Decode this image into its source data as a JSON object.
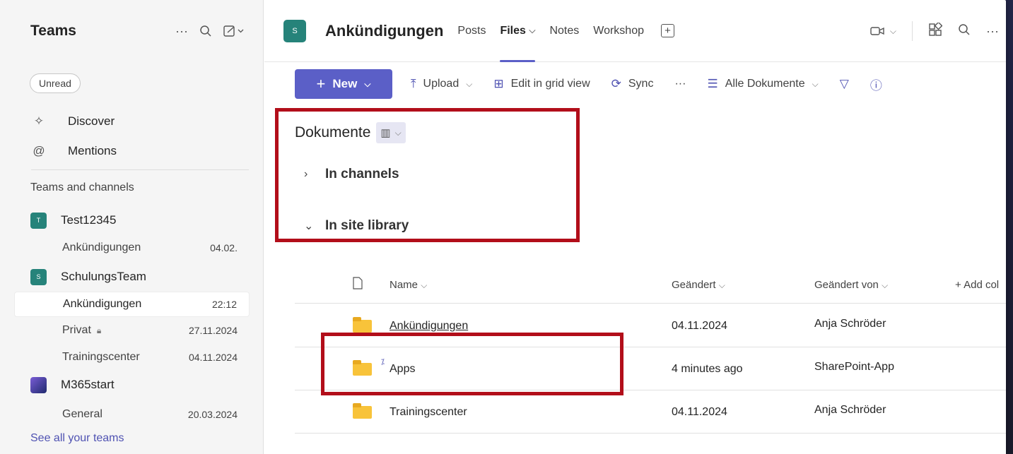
{
  "sidebar": {
    "title": "Teams",
    "filter_pill": "Unread",
    "nav": [
      {
        "label": "Discover",
        "icon": "sparkle-icon"
      },
      {
        "label": "Mentions",
        "icon": "at-icon"
      }
    ],
    "section_label": "Teams and channels",
    "teams": [
      {
        "name": "Test12345",
        "avatar": "T",
        "color": "#26837a",
        "channels": [
          {
            "name": "Ankündigungen",
            "date": "04.02."
          }
        ]
      },
      {
        "name": "SchulungsTeam",
        "avatar": "S",
        "color": "#26837a",
        "channels": [
          {
            "name": "Ankündigungen",
            "date": "22:12"
          },
          {
            "name": "Privat",
            "date": "27.11.2024"
          },
          {
            "name": "Trainingscenter",
            "date": "04.11.2024"
          }
        ]
      },
      {
        "name": "M365start",
        "avatar": "",
        "color": "#3f4a9e",
        "channels": [
          {
            "name": "General",
            "date": "20.03.2024"
          }
        ]
      }
    ],
    "see_all": "See all your teams"
  },
  "header": {
    "avatar": "S",
    "channel_title": "Ankündigungen",
    "tabs": [
      "Posts",
      "Files",
      "Notes",
      "Workshop"
    ],
    "active_tab": "Files"
  },
  "toolbar": {
    "new_label": "New",
    "upload_label": "Upload",
    "grid_label": "Edit in grid view",
    "sync_label": "Sync",
    "more_label": "···",
    "view_label": "Alle Dokumente"
  },
  "library": {
    "title": "Dokumente",
    "in_channels": "In channels",
    "in_site_library": "In site library"
  },
  "columns": {
    "name": "Name",
    "modified": "Geändert",
    "modified_by": "Geändert von",
    "add_column": "+ Add col"
  },
  "files": [
    {
      "name": "Ankündigungen",
      "modified": "04.11.2024",
      "modified_by": "Anja Schröder"
    },
    {
      "name": "Apps",
      "modified": "4 minutes ago",
      "modified_by": "SharePoint-App"
    },
    {
      "name": "Trainingscenter",
      "modified": "04.11.2024",
      "modified_by": "Anja Schröder"
    }
  ],
  "colors": {
    "accent": "#5b5fc7",
    "highlight_box": "#b20e1a",
    "folder": "#f8c33a"
  }
}
